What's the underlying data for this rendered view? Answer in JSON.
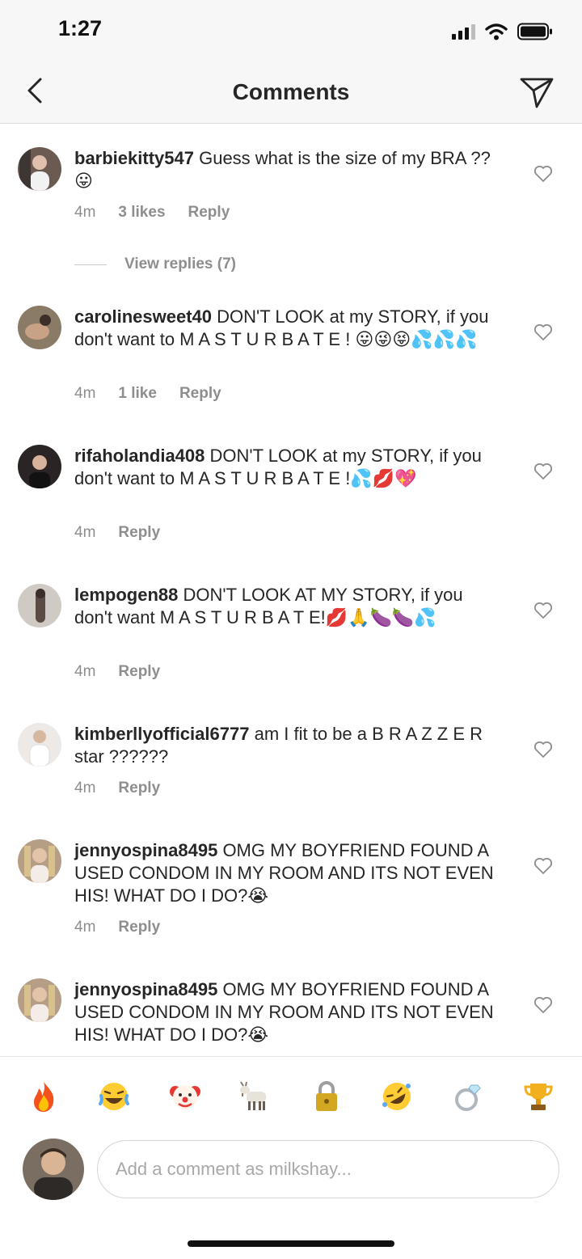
{
  "status": {
    "time": "1:27"
  },
  "header": {
    "title": "Comments"
  },
  "comments": [
    {
      "username": "barbiekitty547",
      "text": "Guess what is the size of my BRA ?? 😛",
      "time": "4m",
      "likes": "3 likes",
      "reply": "Reply",
      "view_replies": "View replies (7)"
    },
    {
      "username": "carolinesweet40",
      "text": "DON'T LOOK at my STORY, if you don't want to  M A S T U R B A T E !  😛😜😝💦💦💦",
      "time": "4m",
      "likes": "1 like",
      "reply": "Reply"
    },
    {
      "username": "rifaholandia408",
      "text": "DON'T LOOK at my STORY, if you don't want to  M A S T U R B A T E !💦💋💖",
      "time": "4m",
      "reply": "Reply"
    },
    {
      "username": "lempogen88",
      "text": "DON'T LOOK AT MY STORY, if you don't want M A S T U R B A T E!💋🙏🍆🍆💦",
      "time": "4m",
      "reply": "Reply"
    },
    {
      "username": "kimberllyofficial6777",
      "text": "am I fit to be a B R A Z Z E R star ??????",
      "time": "4m",
      "reply": "Reply"
    },
    {
      "username": "jennyospina8495",
      "text": "OMG MY BOYFRIEND FOUND A USED CONDOM IN MY ROOM AND ITS NOT EVEN HIS! WHAT DO I DO?😭",
      "time": "4m",
      "reply": "Reply"
    },
    {
      "username": "jennyospina8495",
      "text": "OMG MY BOYFRIEND FOUND A USED CONDOM IN MY ROOM AND ITS NOT EVEN HIS! WHAT DO I DO?😭"
    }
  ],
  "quick_reactions": [
    "🔥",
    "😂",
    "🤡",
    "🐐",
    "🔒",
    "🤣",
    "💍",
    "🏆"
  ],
  "quick_reaction_names": [
    "fire",
    "laughing",
    "clown",
    "goat",
    "lock",
    "rofl",
    "ring",
    "trophy"
  ],
  "composer": {
    "placeholder": "Add a comment as milkshay..."
  },
  "colors": {
    "text": "#262626",
    "secondary": "#8e8e8e",
    "bar_bg": "#f7f7f7"
  }
}
